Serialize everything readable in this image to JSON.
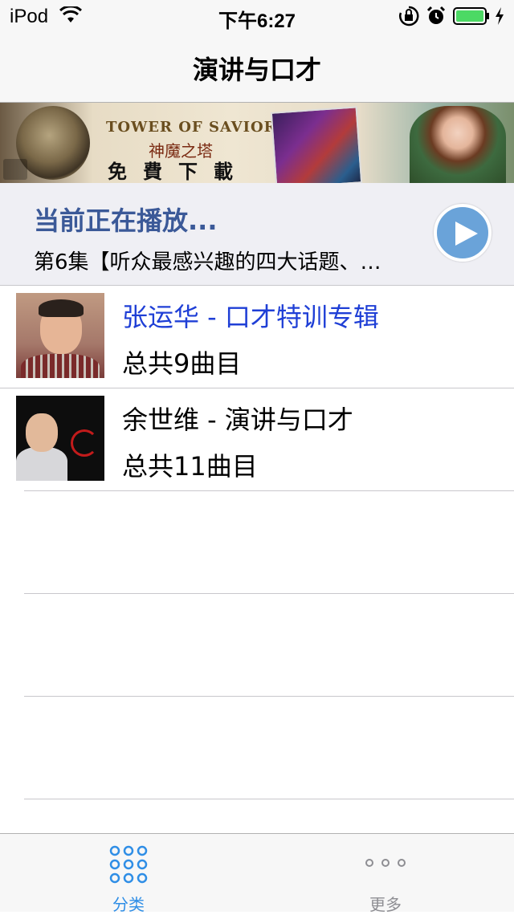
{
  "status_bar": {
    "carrier": "iPod",
    "time": "下午6:27",
    "icons": [
      "wifi-icon",
      "orientation-lock-icon",
      "alarm-icon",
      "battery-icon",
      "charging-icon"
    ],
    "battery_color": "#4cd964"
  },
  "nav": {
    "title": "演讲与口才"
  },
  "banner": {
    "title": "TOWER OF SAVIORS",
    "subtitle": "神魔之塔",
    "cta": "免費下載"
  },
  "now_playing": {
    "title": "当前正在播放...",
    "track": "第6集【听众最感兴趣的四大话题、…",
    "play_color": "#6aa3d9"
  },
  "albums": [
    {
      "title": "张运华 - 口才特训专辑",
      "count": "总共9曲目",
      "selected": true
    },
    {
      "title": "余世维 - 演讲与口才",
      "count": "总共11曲目",
      "selected": false
    }
  ],
  "tabs": [
    {
      "label": "分类",
      "icon": "grid-dots-icon",
      "active": true
    },
    {
      "label": "更多",
      "icon": "more-dots-icon",
      "active": false
    }
  ],
  "colors": {
    "accent": "#2f8ee6",
    "selected_text": "#1f3fd6",
    "now_playing_title": "#3b5998"
  }
}
